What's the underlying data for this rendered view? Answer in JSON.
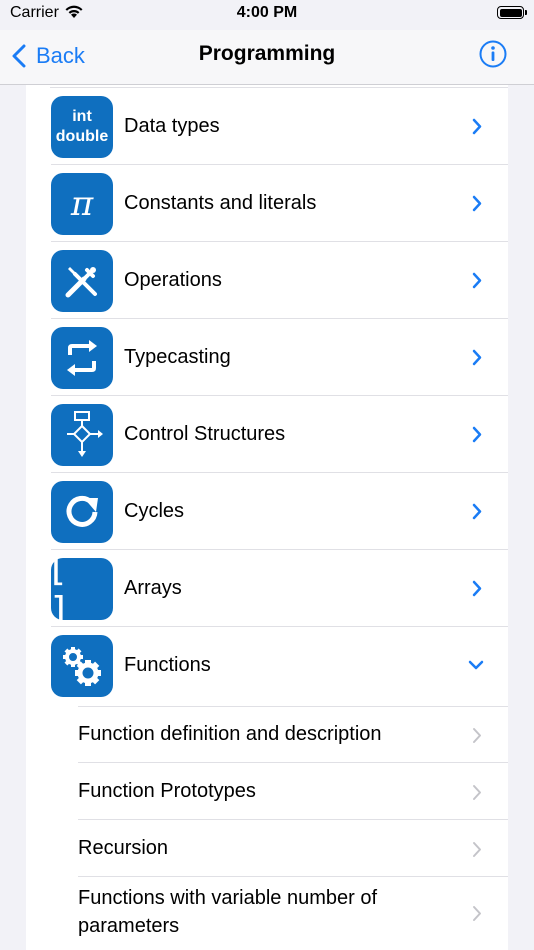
{
  "status_bar": {
    "carrier": "Carrier",
    "time": "4:00 PM"
  },
  "nav": {
    "back_label": "Back",
    "title": "Programming"
  },
  "items": [
    {
      "label": "Data types",
      "icon": "data-types-icon",
      "icon_text_1": "int",
      "icon_text_2": "double"
    },
    {
      "label": "Constants and literals",
      "icon": "pi-icon"
    },
    {
      "label": "Operations",
      "icon": "tools-icon"
    },
    {
      "label": "Typecasting",
      "icon": "convert-icon"
    },
    {
      "label": "Control Structures",
      "icon": "flowchart-icon"
    },
    {
      "label": "Cycles",
      "icon": "loop-icon"
    },
    {
      "label": "Arrays",
      "icon": "brackets-icon",
      "icon_text_1": "[ ]"
    },
    {
      "label": "Functions",
      "icon": "gears-icon",
      "expanded": true
    }
  ],
  "subitems": [
    {
      "label": "Function definition and description"
    },
    {
      "label": "Function Prototypes"
    },
    {
      "label": "Recursion"
    },
    {
      "label": "Functions with variable number of parameters"
    }
  ],
  "colors": {
    "accent": "#1a7cf5",
    "icon_bg": "#0f6fbf",
    "chevron_muted": "#c4c4c9"
  }
}
